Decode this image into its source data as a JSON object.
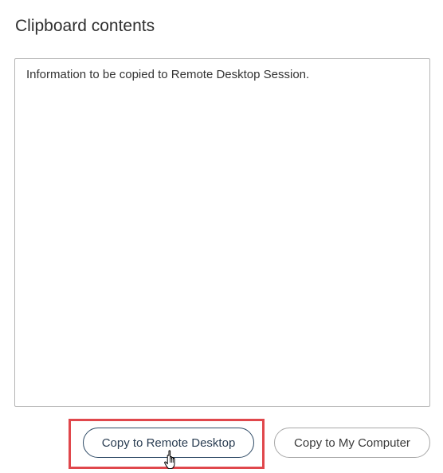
{
  "panel": {
    "title": "Clipboard contents"
  },
  "clipboard": {
    "value": "Information to be copied to Remote Desktop Session."
  },
  "buttons": {
    "copy_to_remote": "Copy to Remote Desktop",
    "copy_to_local": "Copy to My Computer"
  },
  "colors": {
    "highlight": "#e0474c",
    "primary_border": "#2e4a66"
  },
  "icons": {
    "cursor": "hand-pointer-icon"
  }
}
